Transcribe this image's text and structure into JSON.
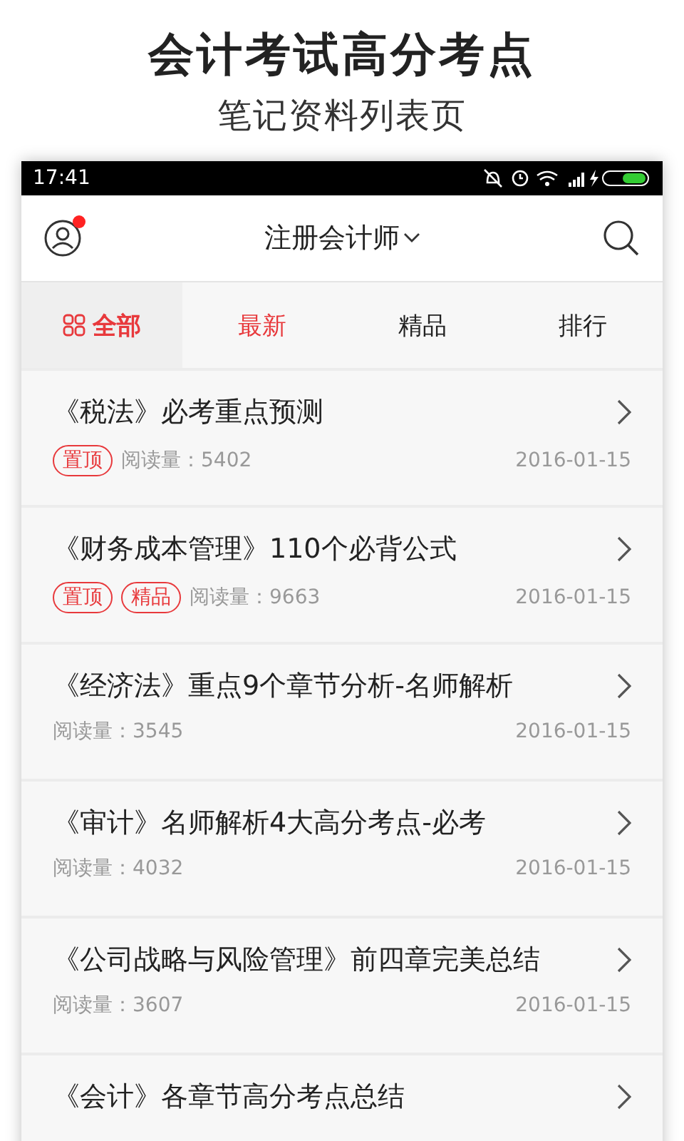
{
  "promo": {
    "title": "会计考试高分考点",
    "subtitle": "笔记资料列表页"
  },
  "status_bar": {
    "time": "17:41"
  },
  "nav": {
    "title": "注册会计师",
    "has_notification": true
  },
  "tabs": [
    {
      "label": "全部",
      "selected": true,
      "highlighted": true,
      "kind": "icon"
    },
    {
      "label": "最新",
      "selected": false,
      "highlighted": true,
      "kind": "plain"
    },
    {
      "label": "精品",
      "selected": false,
      "highlighted": false,
      "kind": "plain"
    },
    {
      "label": "排行",
      "selected": false,
      "highlighted": false,
      "kind": "plain"
    }
  ],
  "articles": [
    {
      "title": "《税法》必考重点预测",
      "tags": [
        "置顶"
      ],
      "reads": "阅读量：5402",
      "date": "2016-01-15"
    },
    {
      "title": "《财务成本管理》110个必背公式",
      "tags": [
        "置顶",
        "精品"
      ],
      "reads": "阅读量：9663",
      "date": "2016-01-15"
    },
    {
      "title": "《经济法》重点9个章节分析-名师解析",
      "reads": "阅读量：3545",
      "date": "2016-01-15"
    },
    {
      "title": "《审计》名师解析4大高分考点-必考",
      "reads": "阅读量：4032",
      "date": "2016-01-15"
    },
    {
      "title": "《公司战略与风险管理》前四章完美总结",
      "reads": "阅读量：3607",
      "date": "2016-01-15"
    },
    {
      "title": "《会计》各章节高分考点总结"
    }
  ]
}
